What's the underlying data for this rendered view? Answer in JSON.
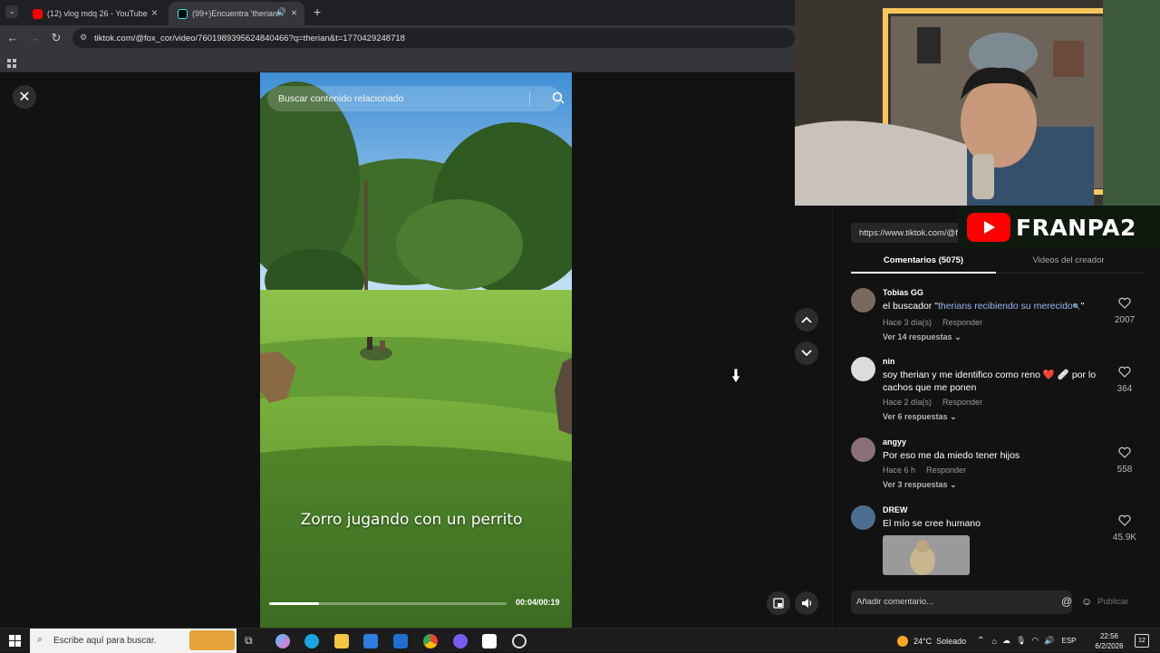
{
  "browser": {
    "tabs": [
      {
        "title": "(12) vlog mdq 26 - YouTube",
        "favicon": "youtube-icon",
        "active": false
      },
      {
        "title": "(99+)Encuentra 'therian' en",
        "favicon": "tiktok-icon",
        "active": true
      }
    ],
    "new_tab_label": "+",
    "url": "tiktok.com/@fox_cor/video/7601989395624840466?q=therian&t=1770429248718"
  },
  "video": {
    "search_placeholder": "Buscar contenido relacionado",
    "caption": "Zorro jugando con un perrito",
    "time": "00:04/00:19",
    "progress": 0.21
  },
  "sidebar": {
    "copy_link": "https://www.tiktok.com/@fox_cor/video/7601989395624840466",
    "tabs": {
      "comments": "Comentarios (5075)",
      "creator_videos": "Videos del creador"
    },
    "comments": [
      {
        "name": "Tobias GG",
        "text_pre": "el buscador \"",
        "text_link": "therians recibiendo su merecido",
        "text_post": "\"",
        "time": "Hace 3 día(s)",
        "reply": "Responder",
        "replies": "Ver 14 respuestas",
        "likes": "2007"
      },
      {
        "name": "nin",
        "text": "soy therian y me identifico como reno ❤️ 🩹 por lo cachos que me ponen",
        "time": "Hace 2 día(s)",
        "reply": "Responder",
        "replies": "Ver 6 respuestas",
        "likes": "364"
      },
      {
        "name": "angyy",
        "text": "Por eso me da miedo tener hijos",
        "time": "Hace 6 h",
        "reply": "Responder",
        "replies": "Ver 3 respuestas",
        "likes": "558"
      },
      {
        "name": "DREW",
        "text": "El mío se cree humano",
        "likes": "45.9K"
      }
    ],
    "comment_placeholder": "Añadir comentario...",
    "publish": "Publicar"
  },
  "overlay": {
    "channel_name": "FRANPA2"
  },
  "taskbar": {
    "search_placeholder": "Escribe aquí para buscar.",
    "weather": "24°C  Soleado",
    "language": "ESP",
    "time": "22:56",
    "date": "6/2/2026",
    "notifications": "12"
  },
  "colors": {
    "accent_link": "#9bb7f6",
    "youtube_red": "#ff0000",
    "page_bg": "#121212"
  }
}
